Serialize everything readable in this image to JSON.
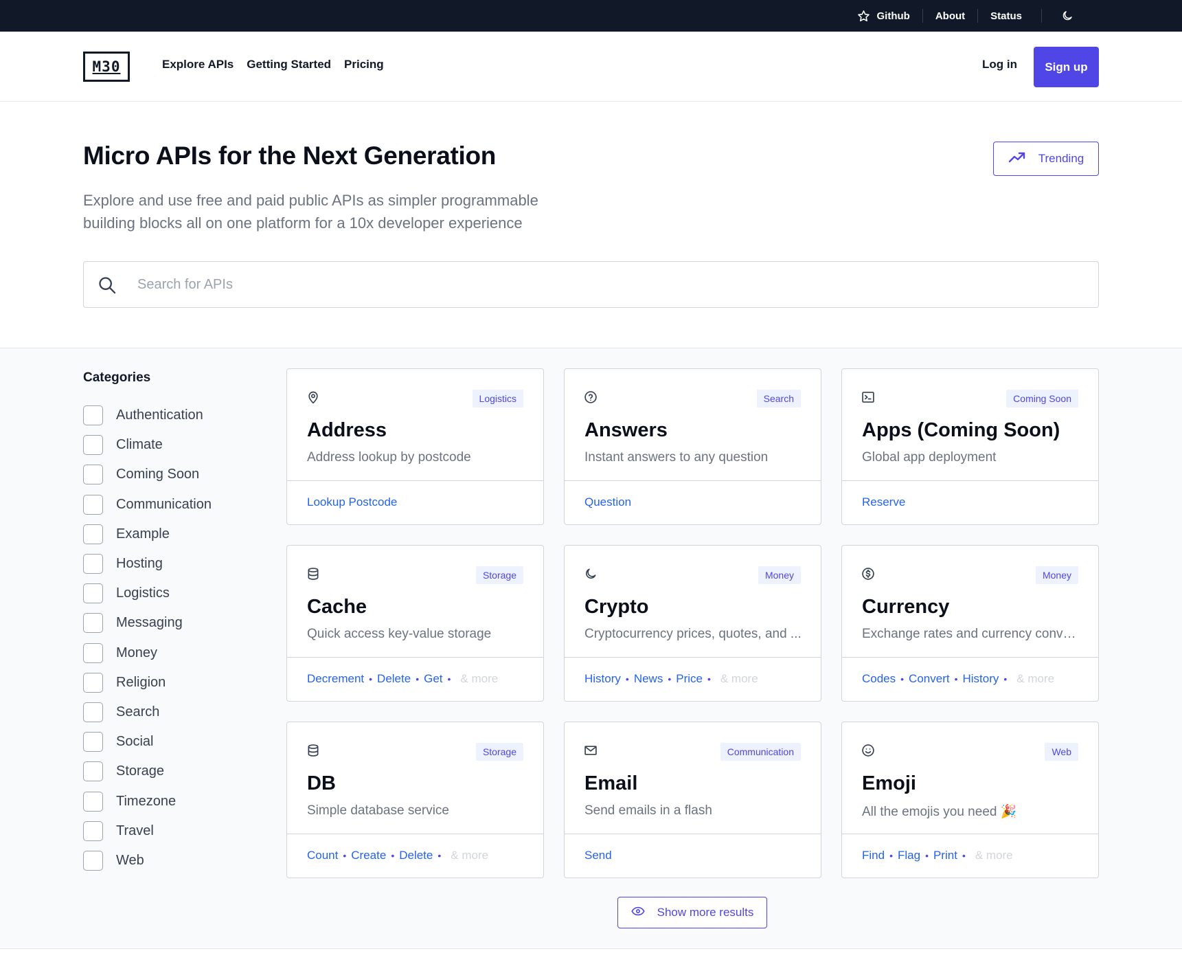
{
  "topbar": {
    "github_label": "Github",
    "about_label": "About",
    "status_label": "Status",
    "icons": {
      "github": "star-icon",
      "theme": "moon-icon"
    }
  },
  "header": {
    "logo_text": "M30",
    "nav": [
      "Explore APIs",
      "Getting Started",
      "Pricing"
    ],
    "login_label": "Log in",
    "signup_label": "Sign up"
  },
  "hero": {
    "title": "Micro APIs for the Next Generation",
    "subtitle": "Explore and use free and paid public APIs as simpler programmable building blocks all on one platform for a 10x developer experience",
    "trending_label": "Trending"
  },
  "search": {
    "placeholder": "Search for APIs",
    "value": ""
  },
  "categories": {
    "title": "Categories",
    "items": [
      "Authentication",
      "Climate",
      "Coming Soon",
      "Communication",
      "Example",
      "Hosting",
      "Logistics",
      "Messaging",
      "Money",
      "Religion",
      "Search",
      "Social",
      "Storage",
      "Timezone",
      "Travel",
      "Web"
    ]
  },
  "cards": [
    {
      "icon": "location-pin-icon",
      "badge": "Logistics",
      "title": "Address",
      "desc": "Address lookup by postcode",
      "links": [
        "Lookup Postcode"
      ],
      "more": ""
    },
    {
      "icon": "question-circle-icon",
      "badge": "Search",
      "title": "Answers",
      "desc": "Instant answers to any question",
      "links": [
        "Question"
      ],
      "more": ""
    },
    {
      "icon": "terminal-icon",
      "badge": "Coming Soon",
      "title": "Apps (Coming Soon)",
      "desc": "Global app deployment",
      "links": [
        "Reserve"
      ],
      "more": ""
    },
    {
      "icon": "database-icon",
      "badge": "Storage",
      "title": "Cache",
      "desc": "Quick access key-value storage",
      "links": [
        "Decrement",
        "Delete",
        "Get"
      ],
      "more": "& more"
    },
    {
      "icon": "moon-icon",
      "badge": "Money",
      "title": "Crypto",
      "desc": "Cryptocurrency prices, quotes, and ...",
      "links": [
        "History",
        "News",
        "Price"
      ],
      "more": "& more"
    },
    {
      "icon": "dollar-circle-icon",
      "badge": "Money",
      "title": "Currency",
      "desc": "Exchange rates and currency conve...",
      "links": [
        "Codes",
        "Convert",
        "History"
      ],
      "more": "& more"
    },
    {
      "icon": "database-icon",
      "badge": "Storage",
      "title": "DB",
      "desc": "Simple database service",
      "links": [
        "Count",
        "Create",
        "Delete"
      ],
      "more": "& more"
    },
    {
      "icon": "envelope-icon",
      "badge": "Communication",
      "title": "Email",
      "desc": "Send emails in a flash",
      "links": [
        "Send"
      ],
      "more": ""
    },
    {
      "icon": "smiley-icon",
      "badge": "Web",
      "title": "Emoji",
      "desc": "All the emojis you need 🎉",
      "links": [
        "Find",
        "Flag",
        "Print"
      ],
      "more": "& more"
    }
  ],
  "show_more_label": "Show more results",
  "colors": {
    "accent": "#4f46e5",
    "topbar": "#111827",
    "link": "#2563eb"
  }
}
